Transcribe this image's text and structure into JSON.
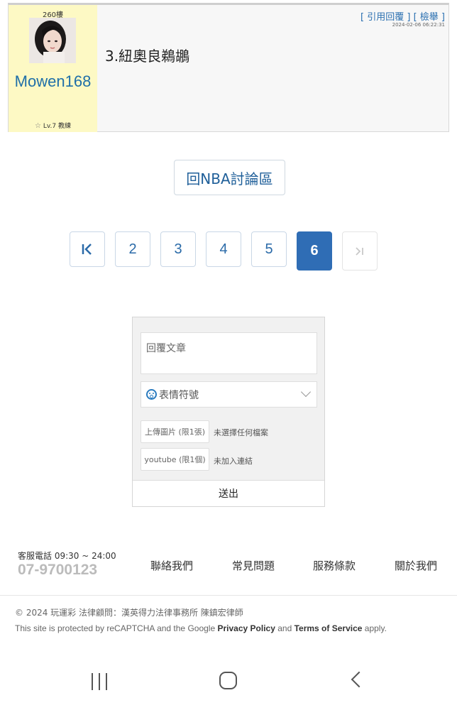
{
  "post": {
    "floor": "260樓",
    "author": "Mowen168",
    "rank": "Lv.7 教練",
    "quote_reply": "[ 引用回覆 ]",
    "report": "[ 檢舉 ]",
    "date": "2024-02-06 06:22:31",
    "content": "3.紐奧良鵜鶘"
  },
  "back_button": "回NBA討論區",
  "pagination": {
    "first_icon": "first-page-icon",
    "pages": [
      "2",
      "3",
      "4",
      "5",
      "6"
    ],
    "current": "6",
    "last_icon": "last-page-icon"
  },
  "reply_form": {
    "placeholder": "回覆文章",
    "emoji_label": "表情符號",
    "upload_image_label": "上傳圖片 (限1張)",
    "upload_image_status": "未選擇任何檔案",
    "youtube_label": "youtube (限1個)",
    "youtube_status": "未加入連結",
    "submit_label": "送出"
  },
  "footer": {
    "service_hours": "客服電話 09:30 ~ 24:00",
    "phone": "07-9700123",
    "links": [
      "聯絡我們",
      "常見問題",
      "服務條款",
      "關於我們"
    ],
    "copyright": "© 2024 玩運彩 法律顧問：漢英得力法律事務所 陳鎮宏律師",
    "recaptcha_prefix": "This site is protected by reCAPTCHA and the Google",
    "privacy_policy": "Privacy Policy",
    "and": "and",
    "terms": "Terms of Service",
    "apply": "apply."
  },
  "colors": {
    "accent": "#2f6db5",
    "author_bg": "#fdf9c4",
    "link": "#1f6fa8"
  }
}
